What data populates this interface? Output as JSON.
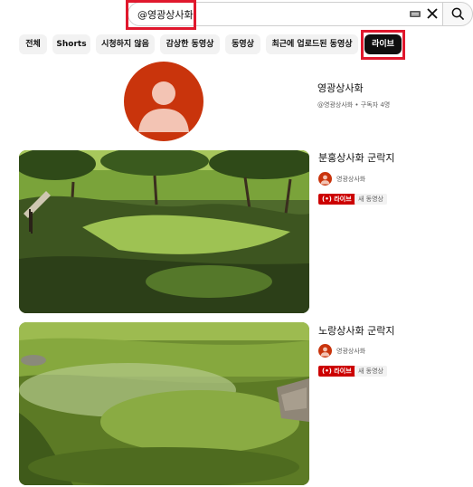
{
  "search": {
    "query": "@영광상사화"
  },
  "chips": [
    "전체",
    "Shorts",
    "시청하지 않음",
    "감상한 동영상",
    "동영상",
    "최근에 업로드된 동영상",
    "라이브"
  ],
  "channel": {
    "name": "영광상사화",
    "meta": "@영광상사화 • 구독자 4명"
  },
  "videos": [
    {
      "title": "분홍상사화 군락지",
      "channel": "영광상사화",
      "live_label": "(•) 라이브",
      "new_label": "새 동영상"
    },
    {
      "title": "노랑상사화 군락지",
      "channel": "영광상사화",
      "live_label": "(•) 라이브",
      "new_label": "새 동영상"
    }
  ],
  "colors": {
    "accent_red": "#cc0000",
    "highlight": "#e0182d",
    "avatar": "#c9340c"
  }
}
